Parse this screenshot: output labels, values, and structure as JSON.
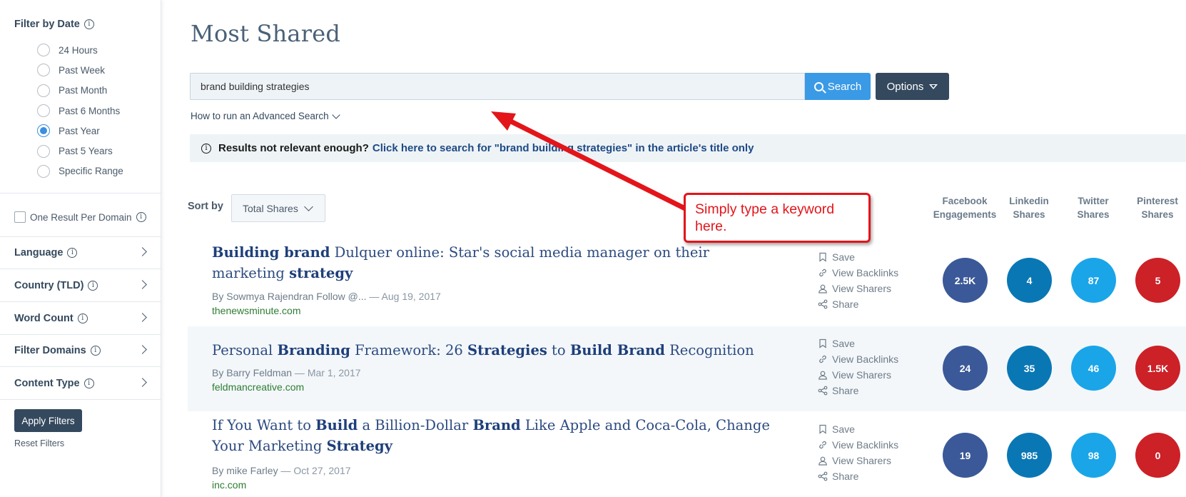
{
  "sidebar": {
    "filter_by_date": "Filter by Date",
    "date_options": [
      {
        "label": "24 Hours",
        "selected": false
      },
      {
        "label": "Past Week",
        "selected": false
      },
      {
        "label": "Past Month",
        "selected": false
      },
      {
        "label": "Past 6 Months",
        "selected": false
      },
      {
        "label": "Past Year",
        "selected": true
      },
      {
        "label": "Past 5 Years",
        "selected": false
      },
      {
        "label": "Specific Range",
        "selected": false
      }
    ],
    "one_result": "One Result Per Domain",
    "sections": [
      "Language",
      "Country (TLD)",
      "Word Count",
      "Filter Domains",
      "Content Type"
    ],
    "apply_label": "Apply Filters",
    "reset_label": "Reset Filters"
  },
  "main": {
    "title": "Most Shared",
    "search_value": "brand building strategies",
    "search_label": "Search",
    "options_label": "Options",
    "advanced_link": "How to run an Advanced Search",
    "relevance_question": "Results not relevant enough?",
    "relevance_link": "Click here to search for \"brand building strategies\" in the article's title only",
    "sort_label": "Sort by",
    "sort_value": "Total Shares",
    "columns": [
      {
        "line1": "Facebook",
        "line2": "Engagements"
      },
      {
        "line1": "Linkedin",
        "line2": "Shares"
      },
      {
        "line1": "Twitter",
        "line2": "Shares"
      },
      {
        "line1": "Pinterest",
        "line2": "Shares"
      }
    ],
    "actions": [
      "Save",
      "View Backlinks",
      "View Sharers",
      "Share"
    ]
  },
  "results": [
    {
      "title_parts": [
        {
          "t": "Building brand",
          "b": true
        },
        {
          "t": " Dulquer online: Star's social media manager on their marketing ",
          "b": false
        },
        {
          "t": "strategy",
          "b": true
        }
      ],
      "author": "By Sowmya Rajendran Follow @...",
      "date": " — Aug 19, 2017",
      "domain": "thenewsminute.com",
      "facebook": "2.5K",
      "linkedin": "4",
      "twitter": "87",
      "pinterest": "5"
    },
    {
      "title_parts": [
        {
          "t": "Personal ",
          "b": false
        },
        {
          "t": "Branding",
          "b": true
        },
        {
          "t": " Framework: 26 ",
          "b": false
        },
        {
          "t": "Strategies",
          "b": true
        },
        {
          "t": " to ",
          "b": false
        },
        {
          "t": "Build Brand",
          "b": true
        },
        {
          "t": " Recognition",
          "b": false
        }
      ],
      "author": "By Barry Feldman",
      "date": " — Mar 1, 2017",
      "domain": "feldmancreative.com",
      "facebook": "24",
      "linkedin": "35",
      "twitter": "46",
      "pinterest": "1.5K"
    },
    {
      "title_parts": [
        {
          "t": "If You Want to ",
          "b": false
        },
        {
          "t": "Build",
          "b": true
        },
        {
          "t": " a Billion-Dollar ",
          "b": false
        },
        {
          "t": "Brand",
          "b": true
        },
        {
          "t": " Like Apple and Coca-Cola, Change Your Marketing ",
          "b": false
        },
        {
          "t": "Strategy",
          "b": true
        }
      ],
      "author": "By  mike Farley",
      "date": " — Oct 27, 2017",
      "domain": "inc.com",
      "facebook": "19",
      "linkedin": "985",
      "twitter": "98",
      "pinterest": "0"
    }
  ],
  "callout": {
    "text": "Simply type a keyword here.",
    "color": "#e3151a"
  },
  "colors": {
    "facebook": "#3b5998",
    "linkedin": "#0a77b5",
    "twitter": "#1aa5e8",
    "pinterest": "#cc2127",
    "accent": "#3a9ae6",
    "navy": "#34495e"
  }
}
